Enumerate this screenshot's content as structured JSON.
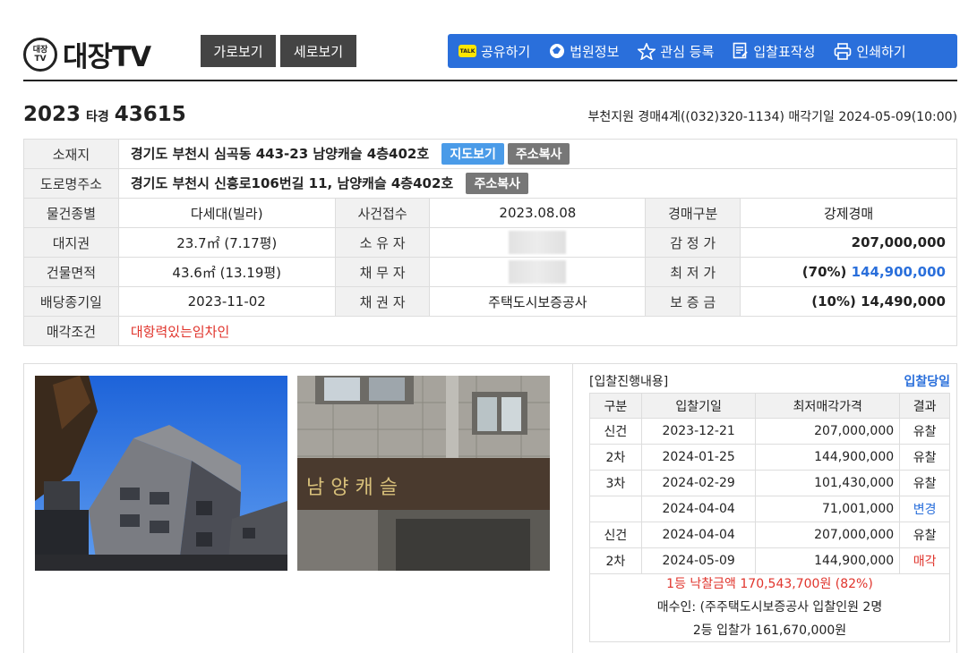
{
  "header": {
    "logo_mark": "대장\nTV",
    "logo_text": "대장TV",
    "view_horizontal": "가로보기",
    "view_vertical": "세로보기",
    "toolbar": {
      "share": "공유하기",
      "court_info": "법원정보",
      "favorite": "관심 등록",
      "bid_form": "입찰표작성",
      "print": "인쇄하기"
    }
  },
  "case": {
    "year": "2023",
    "type": "타경",
    "number": "43615",
    "court_line": "부천지원 경매4계((032)320-1134) 매각기일 2024-05-09(10:00)"
  },
  "info": {
    "location_label": "소재지",
    "location": "경기도 부천시 심곡동 443-23 남양캐슬 4층402호",
    "map_btn": "지도보기",
    "copy_btn": "주소복사",
    "road_label": "도로명주소",
    "road": "경기도 부천시 신흥로106번길 11, 남양캐슬 4층402호",
    "type_label": "물건종별",
    "type": "다세대(빌라)",
    "received_label": "사건접수",
    "received": "2023.08.08",
    "auction_kind_label": "경매구분",
    "auction_kind": "강제경매",
    "land_label": "대지권",
    "land": "23.7㎡ (7.17평)",
    "owner_label": "소 유 자",
    "appraisal_label": "감 정 가",
    "appraisal": "207,000,000",
    "building_label": "건물면적",
    "building": "43.6㎡ (13.19평)",
    "debtor_label": "채 무 자",
    "min_price_label": "최 저 가",
    "min_price_pct": "(70%)",
    "min_price": "144,900,000",
    "dividend_label": "배당종기일",
    "dividend": "2023-11-02",
    "creditor_label": "채 권 자",
    "creditor": "주택도시보증공사",
    "deposit_label": "보 증 금",
    "deposit": "(10%) 14,490,000",
    "conditions_label": "매각조건",
    "conditions": "대항력있는임차인"
  },
  "photos": {
    "sign_text": "남 양 캐 슬"
  },
  "bidding": {
    "title": "[입찰진행내용]",
    "link": "입찰당일",
    "headers": [
      "구분",
      "입찰기일",
      "최저매각가격",
      "결과"
    ],
    "rows": [
      {
        "kind": "신건",
        "date": "2023-12-21",
        "price": "207,000,000",
        "result": "유찰"
      },
      {
        "kind": "2차",
        "date": "2024-01-25",
        "price": "144,900,000",
        "result": "유찰"
      },
      {
        "kind": "3차",
        "date": "2024-02-29",
        "price": "101,430,000",
        "result": "유찰"
      },
      {
        "kind": "",
        "date": "2024-04-04",
        "price": "71,001,000",
        "result": "변경"
      },
      {
        "kind": "신건",
        "date": "2024-04-04",
        "price": "207,000,000",
        "result": "유찰"
      },
      {
        "kind": "2차",
        "date": "2024-05-09",
        "price": "144,900,000",
        "result": "매각"
      }
    ],
    "winning": "1등 낙찰금액 170,543,700원 (82%)",
    "buyer": "매수인: (주주택도시보증공사 입찰인원 2명",
    "second": "2등 입찰가 161,670,000원"
  },
  "colors": {
    "accent": "#2a6fdb",
    "sold": "#e0342c",
    "changed": "#2a6fdb"
  }
}
